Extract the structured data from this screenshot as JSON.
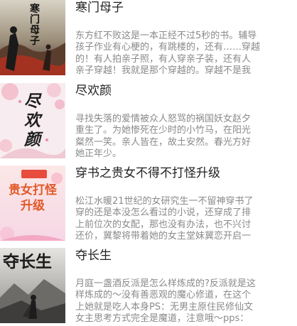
{
  "books": [
    {
      "title": "寒门母子",
      "cover_text": "寒门母子",
      "desc_lines": [
        "东方红不败这是一本正经不过5秒的书。辅导",
        "孩子作业有心梗的，有跳楼的，还有……穿越",
        "的！有人拍亲子照，有人穿亲子装，还有人",
        "亲子穿越！我就是那个穿越的。穿越不是我"
      ]
    },
    {
      "title": "尽欢颜",
      "cover_text": "尽欢颜",
      "desc_lines": [
        "寻找失落的爱情被众人怒骂的祸国妖女赵夕",
        "重生了。为她惨死在少时的小竹马，在阳光",
        "粲然一笑。亲人皆在，故土安然。春光方好",
        "她正年少。"
      ]
    },
    {
      "title": "穿书之贵女不得不打怪升级",
      "cover_text": "贵女打怪升级",
      "desc_lines": [
        "松江水暖21世纪的女研究生一不留神穿书了",
        "穿的还是本没怎么看过的小说，还穿成了排",
        "上前位次的女配，那也没有办法，也不兴讨",
        "还价，冀黎将带着她的女主堂妹冀恋开启一"
      ]
    },
    {
      "title": "夺长生",
      "cover_text": "夺长生",
      "desc_lines": [
        "月庭一盏酒反派是怎么样炼成的?反派就是这",
        "样炼成的～没有善恶观的魔心修道，在这个",
        "上她就是吃人本身PS：无男主原住民修仙文",
        "女主思考方式完全是魔道，注意哦～pps："
      ]
    }
  ]
}
